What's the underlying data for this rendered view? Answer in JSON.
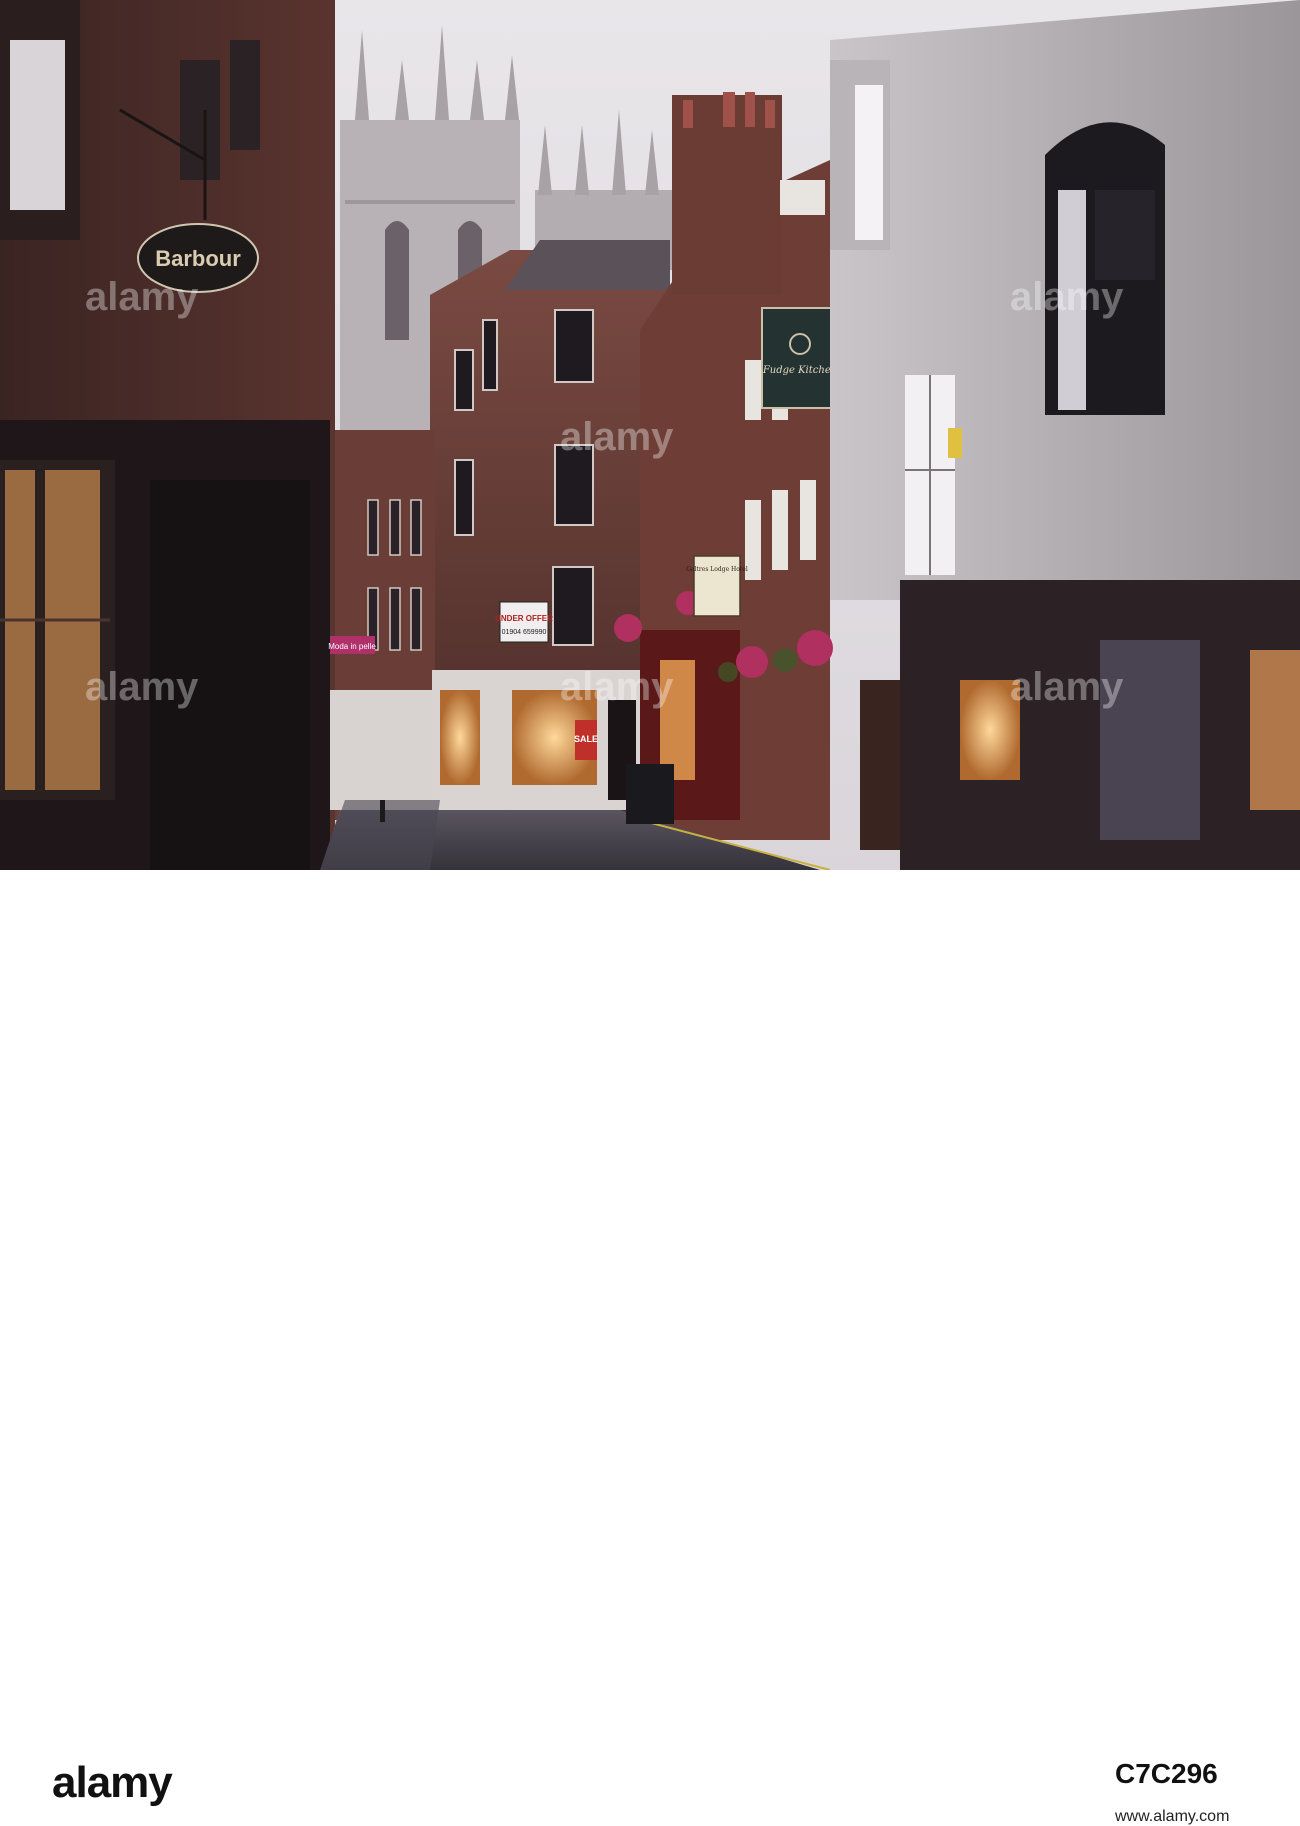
{
  "photo": {
    "description_colors": {
      "sky": "#e6e2e6",
      "brick": "#6e3e36",
      "dusk": "#2b2024",
      "lamp": "#f0b060"
    },
    "signs": {
      "barbour": "Barbour",
      "fudge_kitchen": "Fudge Kitchen",
      "under_offer": "UNDER OFFER",
      "phone": "01904 659990",
      "guest_lodge": "Galtres Lodge Hotel",
      "moda": "Moda in pelle",
      "sale": "SALE"
    },
    "watermark": {
      "logo": "alamy",
      "overlay": "alamy"
    }
  },
  "footer": {
    "logo": "alamy",
    "image_id": "C7C296",
    "stock_photo_text": "www.alamy.com"
  }
}
